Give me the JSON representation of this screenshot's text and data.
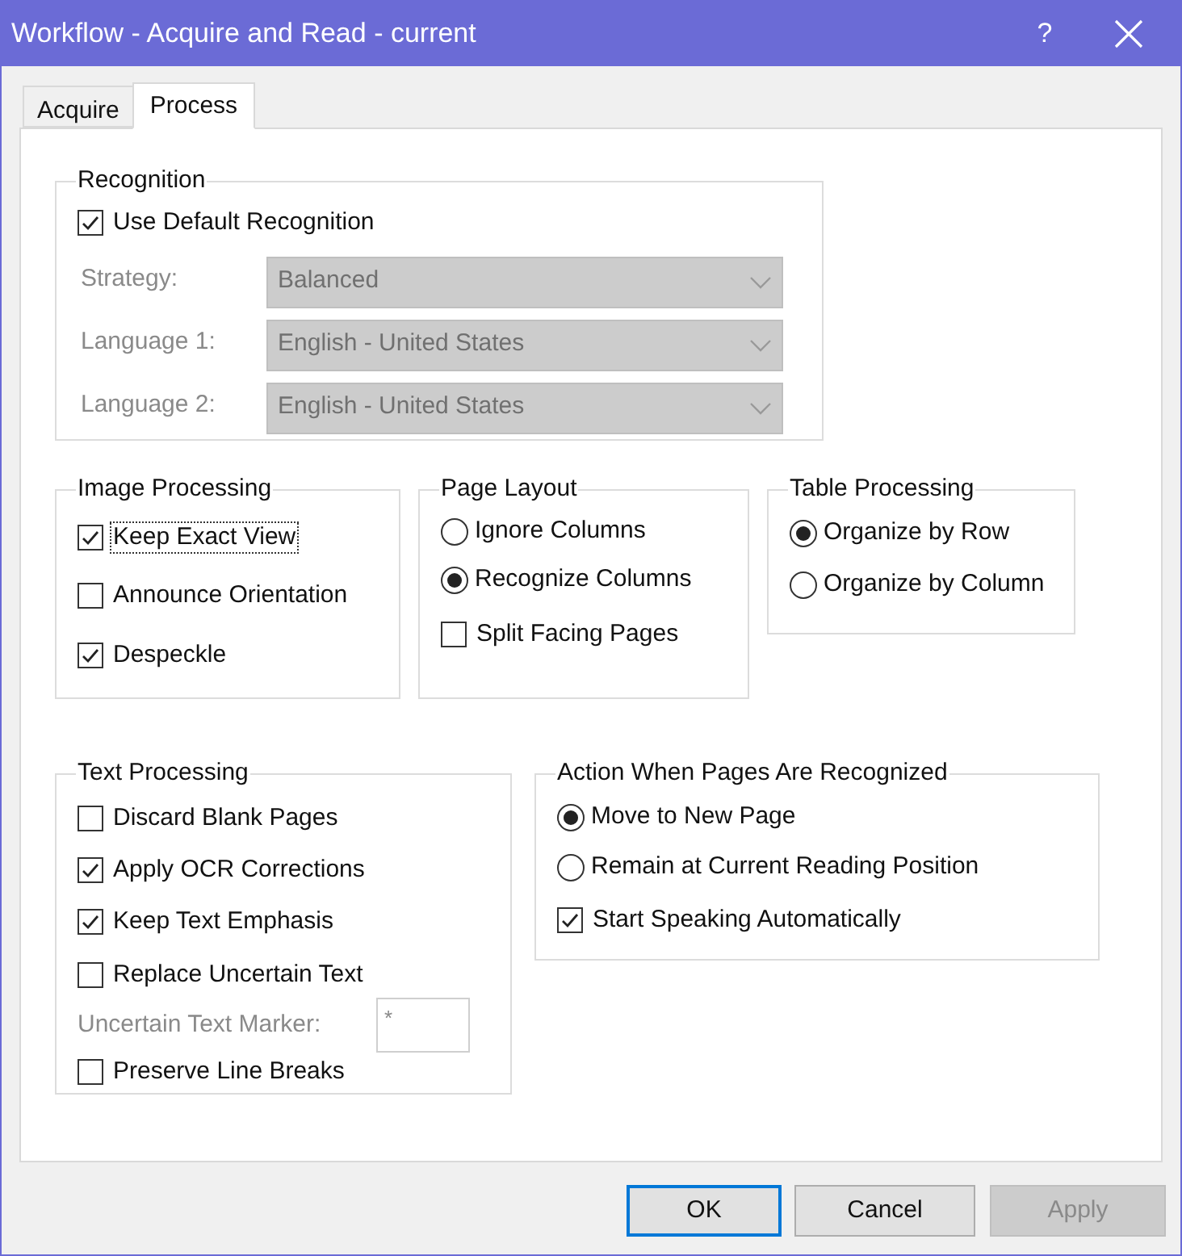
{
  "window": {
    "title": "Workflow - Acquire and Read - current",
    "help": "?"
  },
  "tabs": [
    {
      "label": "Acquire",
      "selected": false
    },
    {
      "label": "Process",
      "selected": true
    }
  ],
  "rows": [
    {
      "groups": [
        {
          "title": "Recognition",
          "items": [
            {
              "kind": "checkbox",
              "label": "Use Default Recognition",
              "checked": true,
              "focused": false
            },
            {
              "kind": "dropdown",
              "label": "Strategy:",
              "value": "Balanced",
              "disabled": true
            },
            {
              "kind": "dropdown",
              "label": "Language 1:",
              "value": "English - United States",
              "disabled": true
            },
            {
              "kind": "dropdown",
              "label": "Language 2:",
              "value": "English - United States",
              "disabled": true
            }
          ]
        }
      ]
    },
    {
      "groups": [
        {
          "title": "Image Processing",
          "items": [
            {
              "kind": "checkbox",
              "label": "Keep Exact View",
              "checked": true,
              "focused": true
            },
            {
              "kind": "checkbox",
              "label": "Announce Orientation",
              "checked": false,
              "focused": false
            },
            {
              "kind": "checkbox",
              "label": "Despeckle",
              "checked": true,
              "focused": false
            }
          ]
        },
        {
          "title": "Page Layout",
          "items": [
            {
              "kind": "radio",
              "label": "Ignore Columns",
              "selected": false
            },
            {
              "kind": "radio",
              "label": "Recognize Columns",
              "selected": true
            },
            {
              "kind": "checkbox",
              "label": "Split Facing Pages",
              "checked": false,
              "focused": false
            }
          ]
        },
        {
          "title": "Table Processing",
          "items": [
            {
              "kind": "radio",
              "label": "Organize by Row",
              "selected": true
            },
            {
              "kind": "radio",
              "label": "Organize by Column",
              "selected": false
            }
          ]
        }
      ]
    },
    {
      "groups": [
        {
          "title": "Text Processing",
          "items": [
            {
              "kind": "checkbox",
              "label": "Discard Blank Pages",
              "checked": false,
              "focused": false
            },
            {
              "kind": "checkbox",
              "label": "Apply OCR Corrections",
              "checked": true,
              "focused": false
            },
            {
              "kind": "checkbox",
              "label": "Keep Text Emphasis",
              "checked": true,
              "focused": false
            },
            {
              "kind": "checkbox",
              "label": "Replace Uncertain Text",
              "checked": false,
              "focused": false
            },
            {
              "kind": "text_field",
              "label": "Uncertain Text Marker:",
              "value": "*",
              "disabled": true
            },
            {
              "kind": "checkbox",
              "label": "Preserve Line Breaks",
              "checked": false,
              "focused": false
            }
          ]
        },
        {
          "title": "Action When Pages Are Recognized",
          "items": [
            {
              "kind": "radio",
              "label": "Move to New Page",
              "selected": true
            },
            {
              "kind": "radio",
              "label": "Remain at Current Reading Position",
              "selected": false
            },
            {
              "kind": "checkbox",
              "label": "Start Speaking Automatically",
              "checked": true,
              "focused": false
            }
          ]
        }
      ]
    }
  ],
  "buttons": [
    {
      "label": "OK",
      "default": true,
      "disabled": false
    },
    {
      "label": "Cancel",
      "default": false,
      "disabled": false
    },
    {
      "label": "Apply",
      "default": false,
      "disabled": true
    }
  ]
}
